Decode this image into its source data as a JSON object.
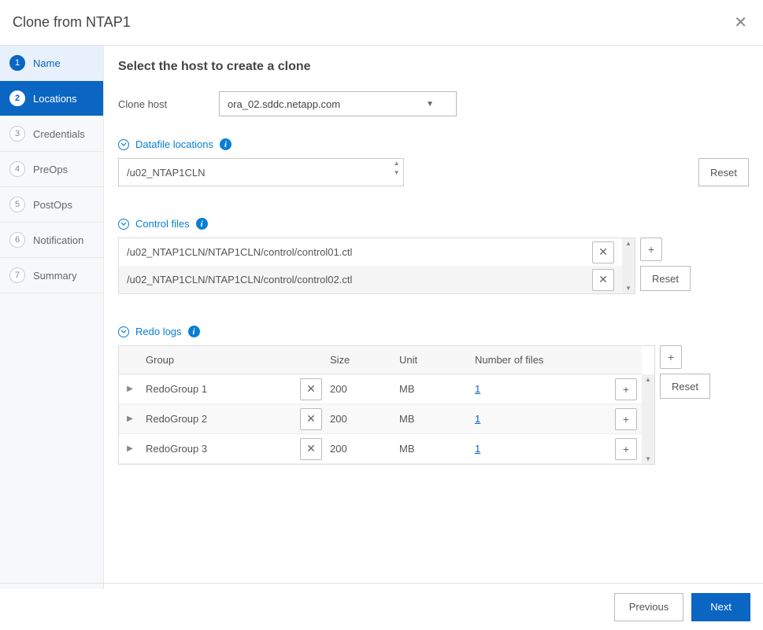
{
  "header": {
    "title": "Clone from NTAP1"
  },
  "steps": [
    {
      "num": "1",
      "label": "Name"
    },
    {
      "num": "2",
      "label": "Locations"
    },
    {
      "num": "3",
      "label": "Credentials"
    },
    {
      "num": "4",
      "label": "PreOps"
    },
    {
      "num": "5",
      "label": "PostOps"
    },
    {
      "num": "6",
      "label": "Notification"
    },
    {
      "num": "7",
      "label": "Summary"
    }
  ],
  "main": {
    "title": "Select the host to create a clone",
    "clone_host_label": "Clone host",
    "clone_host_value": "ora_02.sddc.netapp.com"
  },
  "datafile": {
    "label": "Datafile locations",
    "value": "/u02_NTAP1CLN",
    "reset": "Reset"
  },
  "controlfiles": {
    "label": "Control files",
    "items": [
      "/u02_NTAP1CLN/NTAP1CLN/control/control01.ctl",
      "/u02_NTAP1CLN/NTAP1CLN/control/control02.ctl"
    ],
    "reset": "Reset"
  },
  "redo": {
    "label": "Redo logs",
    "headers": {
      "group": "Group",
      "size": "Size",
      "unit": "Unit",
      "num": "Number of files"
    },
    "rows": [
      {
        "group": "RedoGroup 1",
        "size": "200",
        "unit": "MB",
        "num": "1"
      },
      {
        "group": "RedoGroup 2",
        "size": "200",
        "unit": "MB",
        "num": "1"
      },
      {
        "group": "RedoGroup 3",
        "size": "200",
        "unit": "MB",
        "num": "1"
      }
    ],
    "reset": "Reset"
  },
  "footer": {
    "previous": "Previous",
    "next": "Next"
  }
}
